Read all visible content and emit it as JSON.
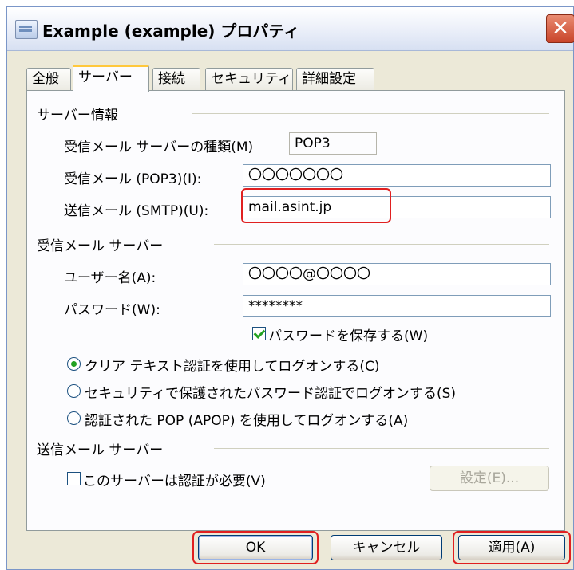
{
  "window": {
    "title": "Example (example) プロパティ",
    "close_label": "✕"
  },
  "tabs": [
    {
      "label": "全般"
    },
    {
      "label": "サーバー"
    },
    {
      "label": "接続"
    },
    {
      "label": "セキュリティ"
    },
    {
      "label": "詳細設定"
    }
  ],
  "server_info": {
    "heading": "サーバー情報",
    "incoming_type_label": "受信メール サーバーの種類(M)",
    "incoming_type_value": "POP3",
    "incoming_label": "受信メール (POP3)(I):",
    "incoming_value": "〇〇〇〇〇〇〇",
    "outgoing_label": "送信メール (SMTP)(U):",
    "outgoing_value": "mail.asint.jp"
  },
  "incoming_server": {
    "heading": "受信メール サーバー",
    "username_label": "ユーザー名(A):",
    "username_value": "〇〇〇〇@〇〇〇〇",
    "password_label": "パスワード(W):",
    "password_value": "********",
    "remember_password_label": "パスワードを保存する(W)",
    "remember_password_checked": true,
    "auth_options": [
      {
        "label": "クリア テキスト認証を使用してログオンする(C)",
        "selected": true
      },
      {
        "label": "セキュリティで保護されたパスワード認証でログオンする(S)",
        "selected": false
      },
      {
        "label": "認証された POP (APOP) を使用してログオンする(A)",
        "selected": false
      }
    ]
  },
  "outgoing_server": {
    "heading": "送信メール サーバー",
    "requires_auth_label": "このサーバーは認証が必要(V)",
    "requires_auth_checked": false,
    "settings_button": "設定(E)..."
  },
  "buttons": {
    "ok": "OK",
    "cancel": "キャンセル",
    "apply": "適用(A)"
  },
  "colors": {
    "highlight": "#e02020",
    "accent_tab": "#ffc83c",
    "check": "#21a121"
  }
}
